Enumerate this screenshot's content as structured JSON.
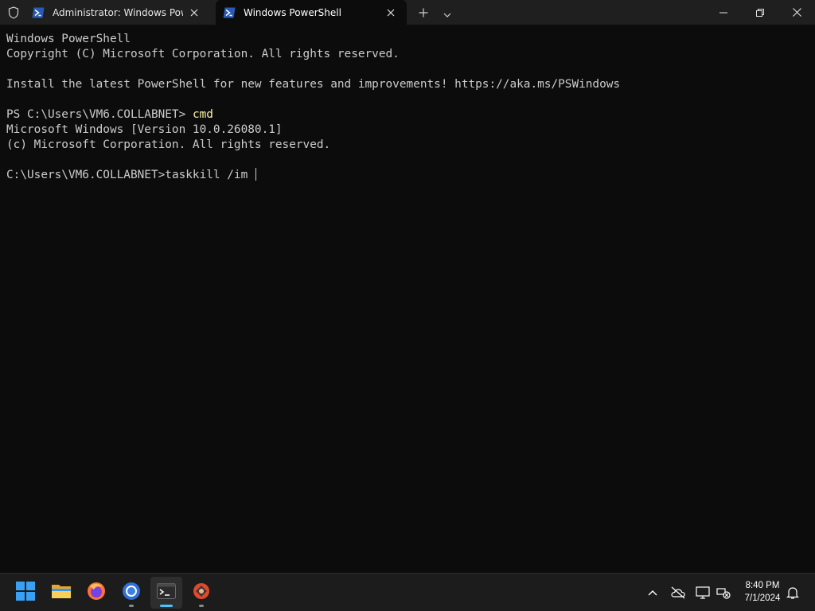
{
  "titlebar": {
    "tabs": [
      {
        "label": "Administrator: Windows PowerShell",
        "active": false
      },
      {
        "label": "Windows PowerShell",
        "active": true
      }
    ],
    "icons": {
      "shield": "shield-icon",
      "tab": "powershell-icon",
      "close": "close-icon",
      "new_tab": "plus-icon",
      "dropdown": "chevron-down-icon",
      "minimize": "minimize-icon",
      "maximize": "restore-icon",
      "window_close": "close-icon"
    }
  },
  "terminal": {
    "lines": [
      "Windows PowerShell",
      "Copyright (C) Microsoft Corporation. All rights reserved.",
      "",
      "Install the latest PowerShell for new features and improvements! https://aka.ms/PSWindows",
      "",
      "Microsoft Windows [Version 10.0.26080.1]",
      "(c) Microsoft Corporation. All rights reserved.",
      ""
    ],
    "ps_prompt": "PS C:\\Users\\VM6.COLLABNET> ",
    "ps_command": "cmd",
    "cmd_prompt": "C:\\Users\\VM6.COLLABNET>",
    "cmd_input": "taskkill /im ",
    "colors": {
      "background": "#0c0c0c",
      "text": "#cccccc",
      "command": "#f9f1a5"
    }
  },
  "taskbar": {
    "apps": [
      "start-icon",
      "file-explorer-icon",
      "firefox-icon",
      "chrome-icon",
      "terminal-icon",
      "app-icon"
    ],
    "tray": [
      "chevron-up-icon",
      "cloud-offline-icon",
      "display-icon",
      "network-icon",
      "notification-bell-icon"
    ],
    "clock": {
      "time": "8:40 PM",
      "date": "7/1/2024"
    },
    "accent": "#4cc2ff"
  }
}
